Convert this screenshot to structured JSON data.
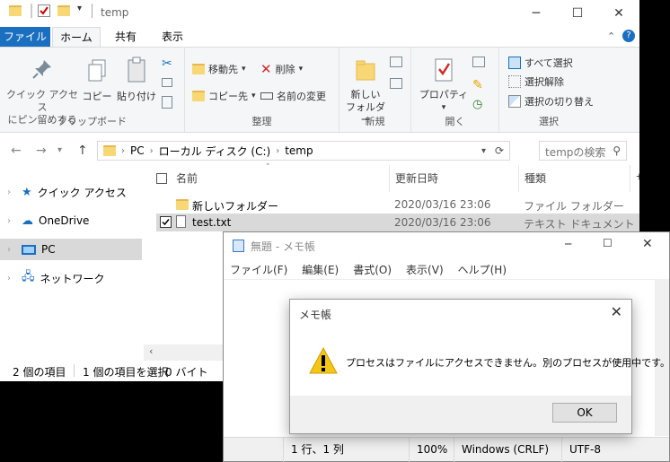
{
  "explorer": {
    "title": "temp",
    "menu_tabs": [
      "ファイル",
      "ホーム",
      "共有",
      "表示"
    ],
    "ribbon": {
      "clipboard": {
        "pin_label_1": "クイック アクセス",
        "pin_label_2": "にピン留めする",
        "copy": "コピー",
        "paste": "貼り付け",
        "group": "クリップボード"
      },
      "organize": {
        "move_to": "移動先",
        "copy_to": "コピー先",
        "delete": "削除",
        "rename": "名前の変更",
        "group": "整理"
      },
      "new": {
        "new_folder_1": "新しい",
        "new_folder_2": "フォルダー",
        "group": "新規"
      },
      "open": {
        "properties": "プロパティ",
        "group": "開く"
      },
      "select": {
        "select_all": "すべて選択",
        "select_none": "選択解除",
        "invert": "選択の切り替え",
        "group": "選択"
      }
    },
    "address": {
      "crumbs": [
        "PC",
        "ローカル ディスク (C:)",
        "temp"
      ],
      "search_placeholder": "tempの検索"
    },
    "nav": [
      {
        "label": "クイック アクセス",
        "icon": "star-icon"
      },
      {
        "label": "OneDrive",
        "icon": "cloud-icon"
      },
      {
        "label": "PC",
        "icon": "computer-icon"
      },
      {
        "label": "ネットワーク",
        "icon": "network-icon"
      }
    ],
    "columns": [
      "名前",
      "更新日時",
      "種類",
      "サ"
    ],
    "files": [
      {
        "name": "新しいフォルダー",
        "modified": "2020/03/16 23:06",
        "type": "ファイル フォルダー"
      },
      {
        "name": "test.txt",
        "modified": "2020/03/16 23:06",
        "type": "テキスト ドキュメント"
      }
    ],
    "status": {
      "count": "2 個の項目",
      "selected": "1 個の項目を選択",
      "size": "0 バイト"
    }
  },
  "notepad": {
    "title": "無題 - メモ帳",
    "menu": [
      "ファイル(F)",
      "編集(E)",
      "書式(O)",
      "表示(V)",
      "ヘルプ(H)"
    ],
    "status": {
      "position": "1 行、1 列",
      "zoom": "100%",
      "eol": "Windows (CRLF)",
      "encoding": "UTF-8"
    }
  },
  "dialog": {
    "title": "メモ帳",
    "message": "プロセスはファイルにアクセスできません。別のプロセスが使用中です。",
    "ok": "OK"
  },
  "colors": {
    "file_tab": "#1a6fc0",
    "selection": "#d9d9d9",
    "warning": "#f5c518"
  }
}
